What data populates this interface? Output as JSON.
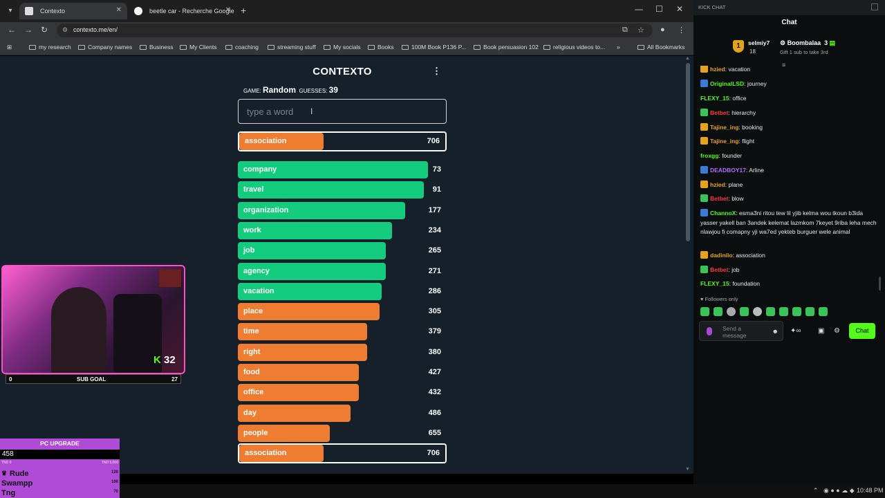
{
  "browser": {
    "tabs": [
      {
        "title": "Contexto",
        "active": true
      },
      {
        "title": "beetle car - Recherche Google",
        "active": false
      }
    ],
    "url": "contexto.me/en/",
    "bookmarks": [
      "my research",
      "Company names",
      "Business",
      "My Clients",
      "coaching",
      "streaming stuff",
      "My socials",
      "Books",
      "100M Book P136 P...",
      "Book persuasion 102",
      "religious videos to..."
    ],
    "all_bookmarks": "All Bookmarks",
    "more": "»"
  },
  "game": {
    "logo": "CONTEXTO",
    "game_label": "GAME:",
    "game_value": "Random",
    "guesses_label": "GUESSES:",
    "guesses_value": "39",
    "placeholder": "type a word",
    "last_guess": {
      "word": "association",
      "rank": 706
    },
    "guesses": [
      {
        "word": "company",
        "rank": 73,
        "fill": 0.91,
        "color": "green"
      },
      {
        "word": "travel",
        "rank": 91,
        "fill": 0.89,
        "color": "green"
      },
      {
        "word": "organization",
        "rank": 177,
        "fill": 0.8,
        "color": "green"
      },
      {
        "word": "work",
        "rank": 234,
        "fill": 0.74,
        "color": "green"
      },
      {
        "word": "job",
        "rank": 265,
        "fill": 0.71,
        "color": "green"
      },
      {
        "word": "agency",
        "rank": 271,
        "fill": 0.71,
        "color": "green"
      },
      {
        "word": "vacation",
        "rank": 286,
        "fill": 0.69,
        "color": "green"
      },
      {
        "word": "place",
        "rank": 305,
        "fill": 0.68,
        "color": "orange"
      },
      {
        "word": "time",
        "rank": 379,
        "fill": 0.62,
        "color": "orange"
      },
      {
        "word": "right",
        "rank": 380,
        "fill": 0.62,
        "color": "orange"
      },
      {
        "word": "food",
        "rank": 427,
        "fill": 0.58,
        "color": "orange"
      },
      {
        "word": "office",
        "rank": 432,
        "fill": 0.58,
        "color": "orange"
      },
      {
        "word": "day",
        "rank": 486,
        "fill": 0.54,
        "color": "orange"
      },
      {
        "word": "people",
        "rank": 655,
        "fill": 0.44,
        "color": "orange"
      },
      {
        "word": "association",
        "rank": 706,
        "fill": 0.41,
        "color": "orange",
        "highlight": true
      }
    ],
    "colors": {
      "green": "#14cc7d",
      "orange": "#ef7d31",
      "bg": "#15202b"
    }
  },
  "stream": {
    "sub_count": "32",
    "sub_goal_label": "SUB GOAL",
    "sub_goal_start": "0",
    "sub_goal_end": "27",
    "pc_upgrade": {
      "title": "PC UPGRADE",
      "value": "458",
      "min": "TND 0",
      "max": "TND 5,000",
      "entries": [
        {
          "name": "Rude",
          "value": "120"
        },
        {
          "name": "Swampp",
          "value": "100"
        },
        {
          "name": "Tng",
          "value": "70"
        }
      ]
    }
  },
  "chat": {
    "window_title": "KICK CHAT",
    "title": "Chat",
    "pinned": {
      "user": "selmiy7",
      "count": "18",
      "gifter": "Boombalaa",
      "gifts": "3",
      "hint": "Gift 1 sub to take 3rd"
    },
    "messages": [
      {
        "user": "hzied",
        "text": "vacation",
        "color": "#e6a317",
        "badge": "#e6a317"
      },
      {
        "user": "OriginalLSD",
        "text": "journey",
        "color": "#53fc18",
        "badge": "#3a7bd5"
      },
      {
        "user": "FLEXY_15",
        "text": "office",
        "color": "#53fc18",
        "badge": ""
      },
      {
        "user": "Betbet",
        "text": "hierarchy",
        "color": "#ff3a3a",
        "badge": "#39c45a"
      },
      {
        "user": "Tajine_ing",
        "text": "booking",
        "color": "#e6a317",
        "badge": "#e6a317"
      },
      {
        "user": "Tajine_ing",
        "text": "flight",
        "color": "#e6a317",
        "badge": "#e6a317"
      },
      {
        "user": "froxgg",
        "text": "founder",
        "color": "#53fc18",
        "badge": ""
      },
      {
        "user": "DEADBOY17",
        "text": "Arline",
        "color": "#b36bff",
        "badge": "#3a7bd5"
      },
      {
        "user": "hzied",
        "text": "plane",
        "color": "#e6a317",
        "badge": "#e6a317"
      },
      {
        "user": "Betbet",
        "text": "blow",
        "color": "#ff3a3a",
        "badge": "#39c45a"
      },
      {
        "user": "ChannoX",
        "text": "esma3ni ritou tew lil yjib kelma wou tkoun b3ida yasser yakell ban 3andek kelemat lazmkom 7keyet 9riba leha mech nlawjou fi comapny yji wa7ed yekteb burguer wele animal",
        "color": "#53fc18",
        "badge": "#3a7bd5"
      },
      {
        "user": "dadinilo",
        "text": "association",
        "color": "#e6a317",
        "badge": "#e6a317"
      },
      {
        "user": "Betbet",
        "text": "job",
        "color": "#ff3a3a",
        "badge": "#39c45a"
      },
      {
        "user": "FLEXY_15",
        "text": "foundation",
        "color": "#53fc18",
        "badge": ""
      }
    ],
    "followers_only": "Followers only",
    "send_placeholder": "Send a message",
    "chat_button": "Chat"
  },
  "taskbar": {
    "time": "10:48 PM"
  }
}
